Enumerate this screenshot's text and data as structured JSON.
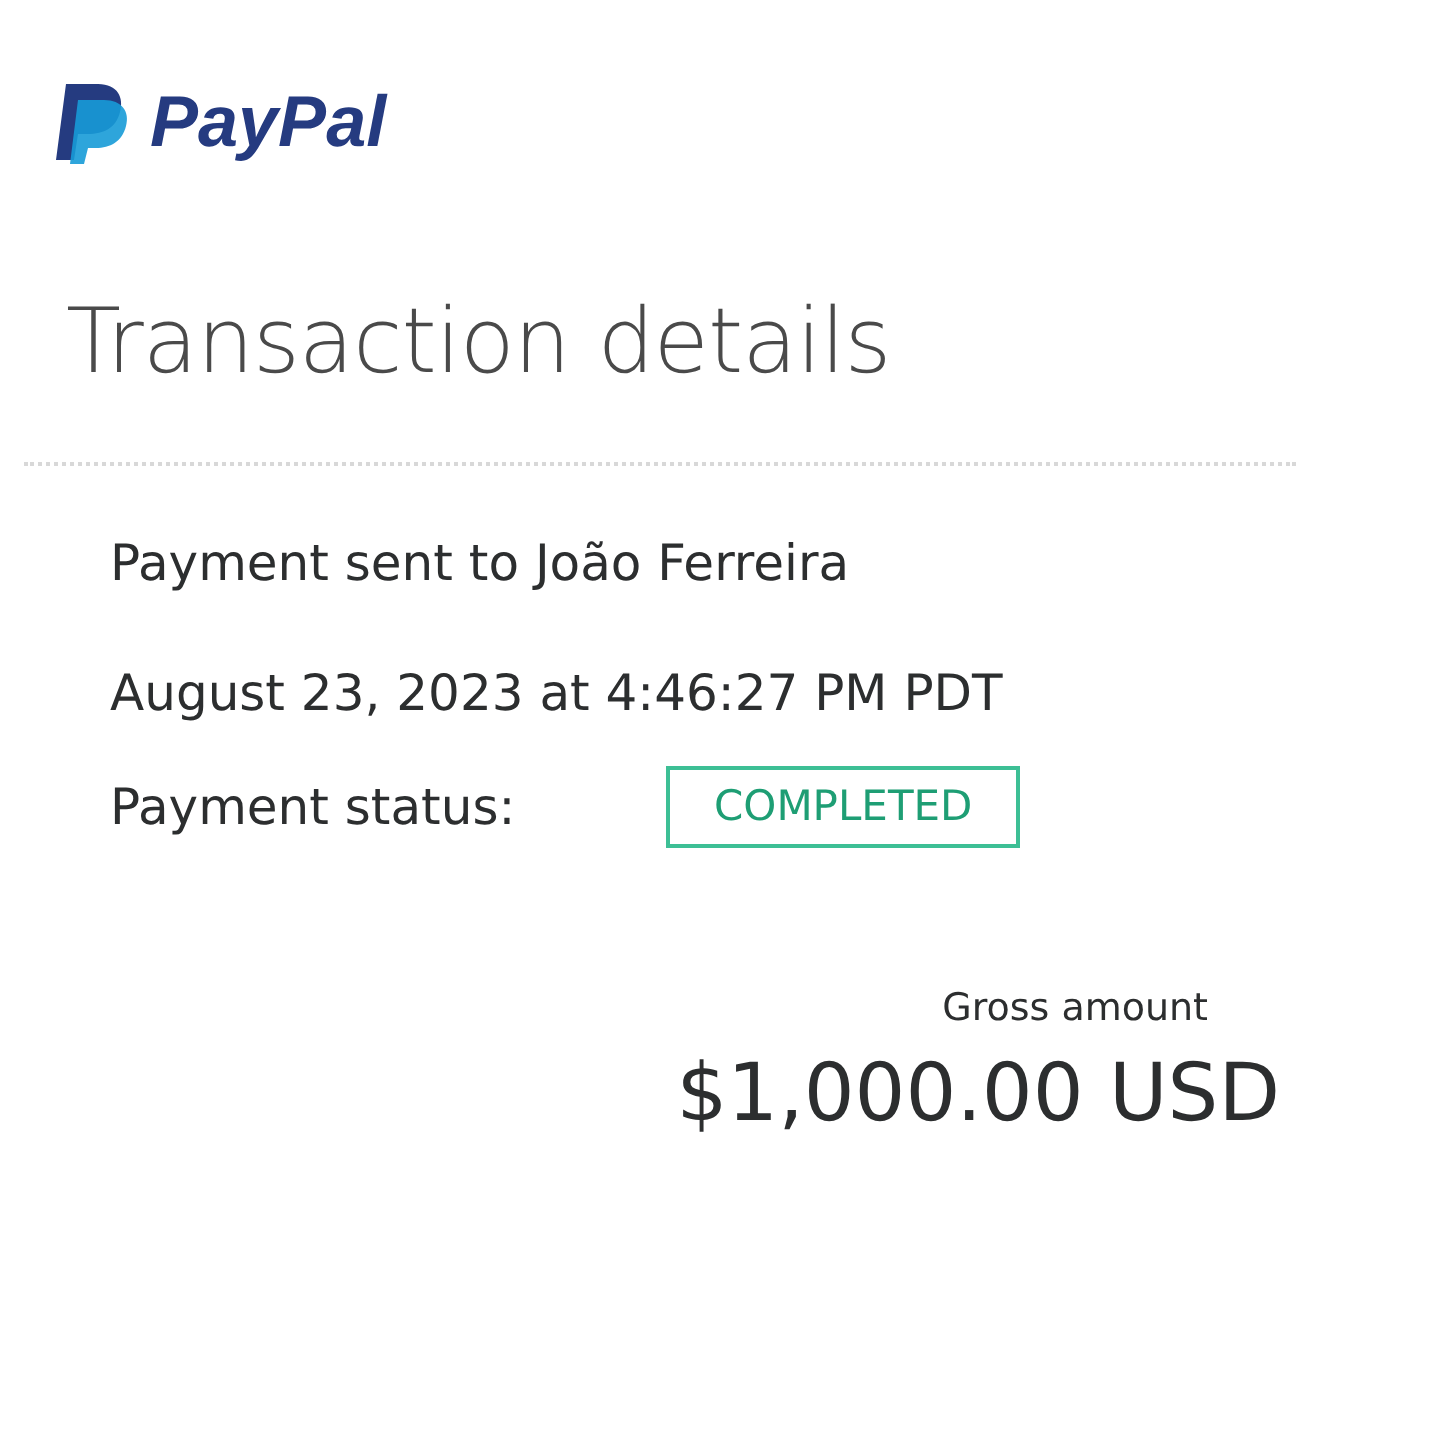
{
  "logo": {
    "wordmark": "PayPal"
  },
  "title": "Transaction details",
  "details": [
    "Payment sent to João Ferreira",
    "August 23, 2023 at 4:46:27 PM PDT"
  ],
  "status": {
    "label": "Payment status:",
    "badge": "COMPLETED"
  },
  "gross": {
    "label": "Gross amount",
    "amount": "$1,000.00 USD"
  }
}
